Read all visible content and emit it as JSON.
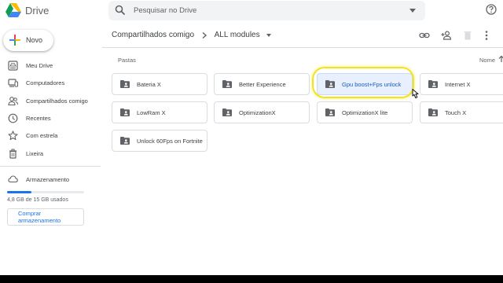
{
  "app": {
    "name": "Drive"
  },
  "search": {
    "placeholder": "Pesquisar no Drive"
  },
  "sidebar": {
    "new_label": "Novo",
    "items": [
      {
        "label": "Meu Drive",
        "icon": "my-drive-icon"
      },
      {
        "label": "Computadores",
        "icon": "computer-icon"
      },
      {
        "label": "Compartilhados comigo",
        "icon": "shared-people-icon"
      },
      {
        "label": "Recentes",
        "icon": "clock-icon"
      },
      {
        "label": "Com estrela",
        "icon": "star-icon"
      },
      {
        "label": "Lixeira",
        "icon": "trash-icon"
      }
    ],
    "storage": {
      "title": "Armazenamento",
      "used_text": "4,8 GB de 15 GB usados",
      "used_fraction": 0.32,
      "buy_label": "Comprar armazenamento"
    }
  },
  "breadcrumb": {
    "parent": "Compartilhados comigo",
    "current": "ALL modules"
  },
  "main": {
    "section_label": "Pastas",
    "sort_label": "Nome",
    "folders": [
      {
        "name": "Bateria X",
        "selected": false
      },
      {
        "name": "Better Experience",
        "selected": false
      },
      {
        "name": "Gpu boost+Fps unlock",
        "selected": true
      },
      {
        "name": "Internet X",
        "selected": false
      },
      {
        "name": "LowRam X",
        "selected": false
      },
      {
        "name": "OptimizationX",
        "selected": false
      },
      {
        "name": "OptimizationX lite",
        "selected": false
      },
      {
        "name": "Touch X",
        "selected": false
      },
      {
        "name": "Unlock 60Fps on Fortnite",
        "selected": false
      }
    ]
  },
  "colors": {
    "accent": "#1a73e8",
    "selected_bg": "#e8f0fe",
    "highlight": "#f4e21c"
  }
}
